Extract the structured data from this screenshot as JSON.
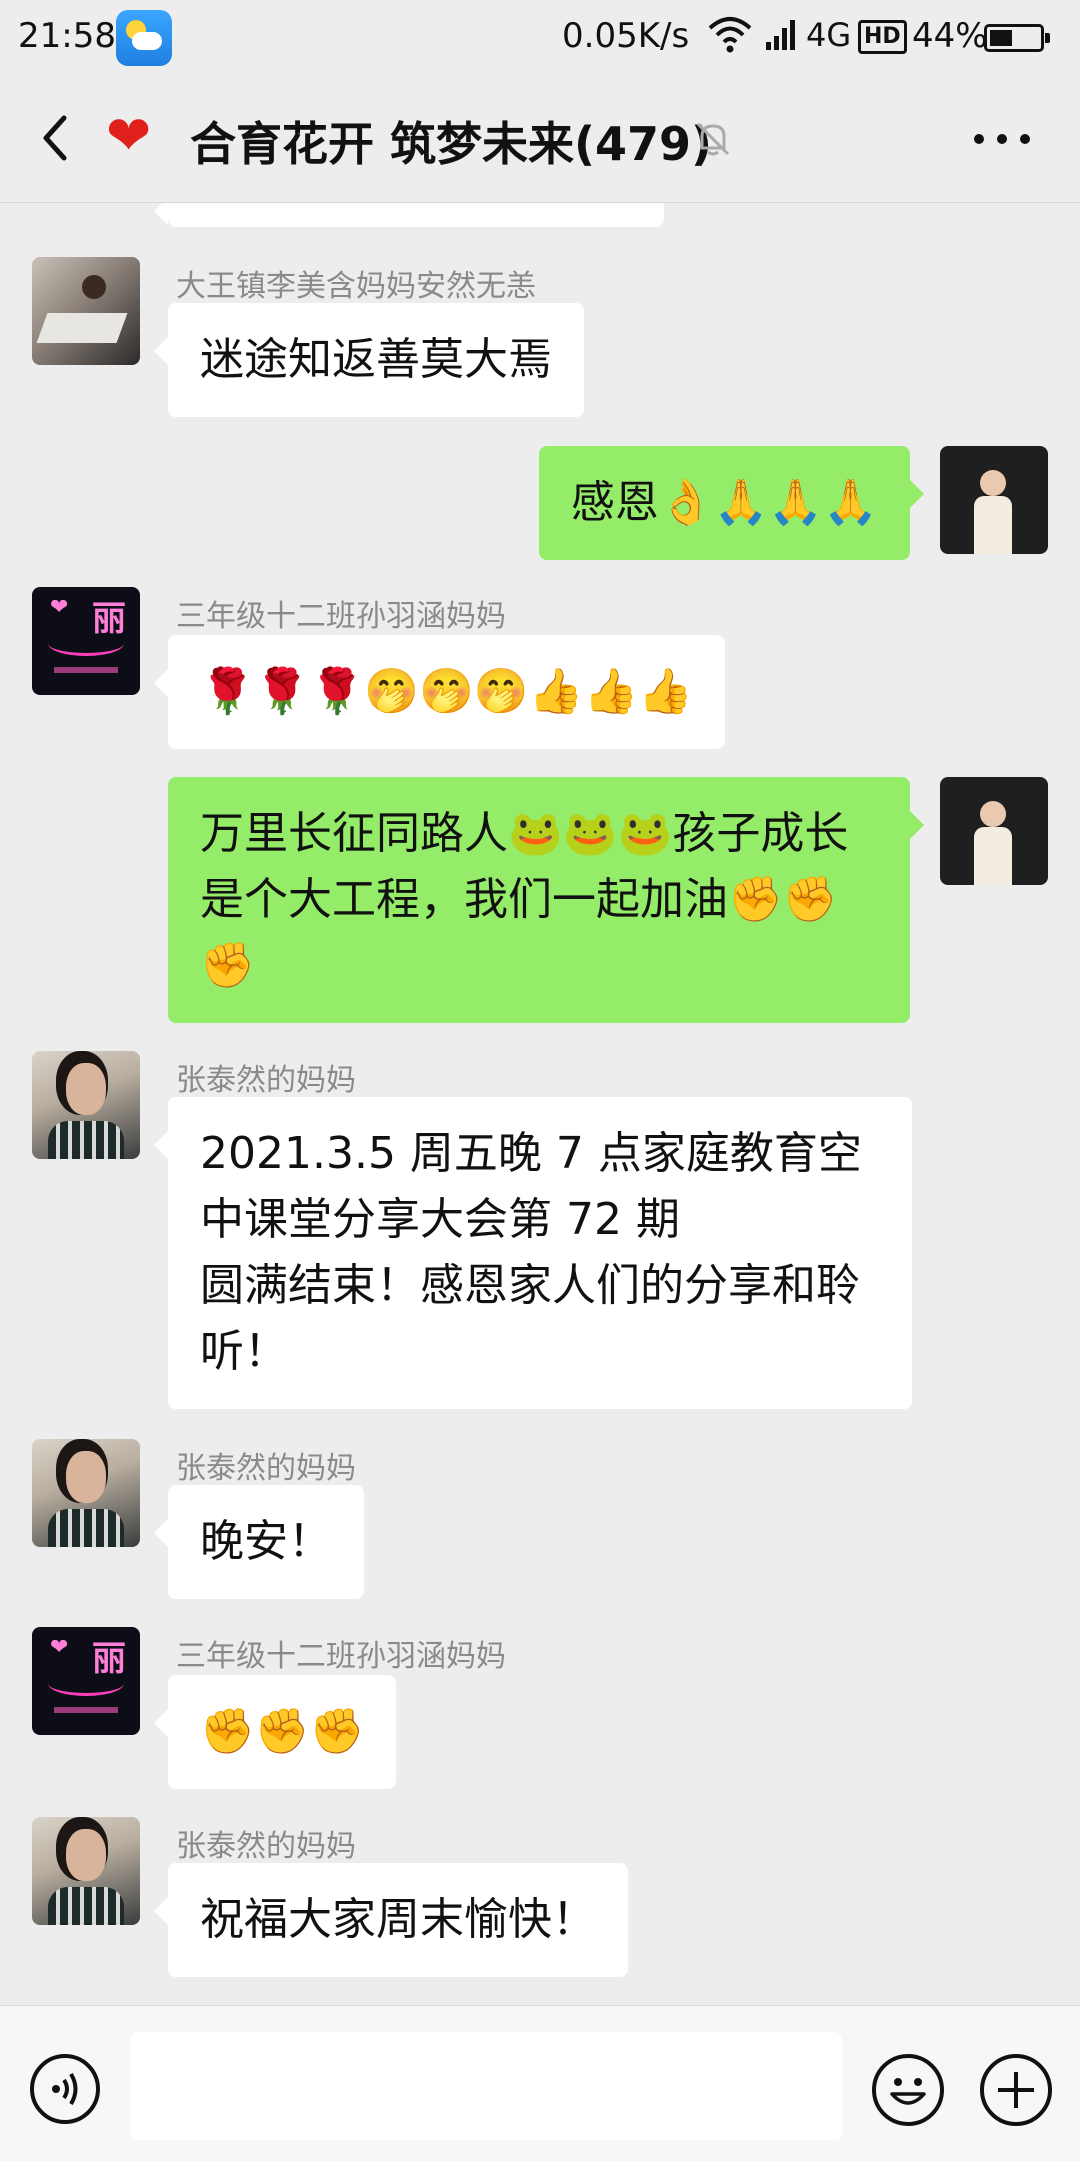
{
  "status": {
    "time": "21:58",
    "speed": "0.05K/s",
    "network": "4G",
    "hd": "HD",
    "battery": "44%"
  },
  "header": {
    "title": "合育花开 筑梦未来(479)"
  },
  "messages": [
    {
      "sender": "大王镇李美含妈妈安然无恙",
      "text": "迷途知返善莫大焉"
    },
    {
      "text": "感恩👌🙏🙏🙏"
    },
    {
      "sender": "三年级十二班孙羽涵妈妈",
      "text": "🌹🌹🌹🤭🤭🤭👍👍👍",
      "avatar_text": "丽"
    },
    {
      "text": "万里长征同路人🐸🐸🐸孩子成长是个大工程，我们一起加油✊✊✊"
    },
    {
      "sender": "张泰然的妈妈",
      "text": "2021.3.5 周五晚 7 点家庭教育空中课堂分享大会第 72 期\n圆满结束！感恩家人们的分享和聆听！"
    },
    {
      "sender": "张泰然的妈妈",
      "text": "晚安！"
    },
    {
      "sender": "三年级十二班孙羽涵妈妈",
      "text": "✊✊✊",
      "avatar_text": "丽"
    },
    {
      "sender": "张泰然的妈妈",
      "text": "祝福大家周末愉快！"
    }
  ],
  "input": {
    "placeholder": ""
  },
  "icons": {
    "back": "chevron-left-icon",
    "mute": "bell-off-icon",
    "more": "more-dots-icon",
    "voice": "voice-icon",
    "emoji": "smiley-icon",
    "plus": "plus-icon"
  }
}
